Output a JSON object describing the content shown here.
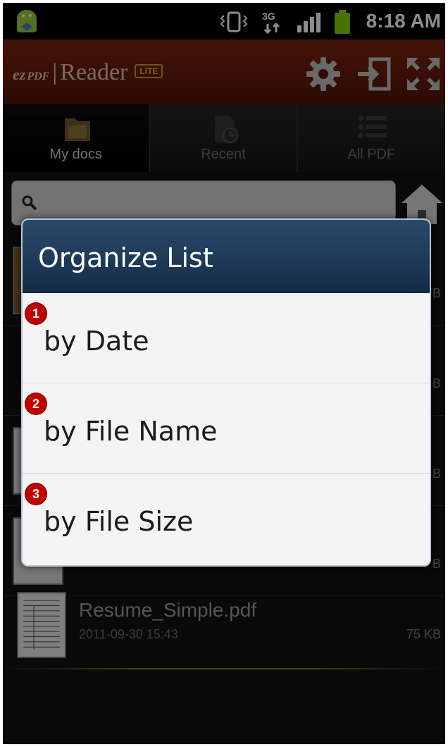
{
  "status_bar": {
    "time": "8:18 AM",
    "network_label": "3G",
    "icons": [
      "android-icon",
      "vibrate-icon",
      "network-3g-icon",
      "signal-icon",
      "battery-icon"
    ]
  },
  "app_header": {
    "logo_ez": "ez",
    "logo_pdf": "PDF",
    "logo_sep": "|",
    "logo_reader": "Reader",
    "logo_lite": "LITE",
    "icons": [
      "settings-icon",
      "import-icon",
      "fullscreen-icon"
    ]
  },
  "tabs": [
    {
      "label": "My docs",
      "icon": "folder-icon",
      "active": true
    },
    {
      "label": "Recent",
      "icon": "recent-icon",
      "active": false
    },
    {
      "label": "All PDF",
      "icon": "list-icon",
      "active": false
    }
  ],
  "search": {
    "icon": "search-icon"
  },
  "file_list": {
    "rows": [
      {
        "name": "",
        "date": "",
        "size": "B"
      },
      {
        "name": "",
        "date": "",
        "size": "B"
      },
      {
        "name": "",
        "date": "",
        "size": "B"
      },
      {
        "name": "",
        "date": "",
        "size": "B"
      },
      {
        "name": "Resume_Simple.pdf",
        "date": "2011-09-30 15:43",
        "size": "75 KB"
      }
    ]
  },
  "dialog": {
    "title": "Organize List",
    "options": [
      {
        "badge": "1",
        "label": "by Date"
      },
      {
        "badge": "2",
        "label": "by File Name"
      },
      {
        "badge": "3",
        "label": "by File Size"
      }
    ]
  },
  "colors": {
    "header_red": "#6a1c0c",
    "dialog_blue": "#1e3a58",
    "badge_red": "#c00000",
    "dialog_bg": "#f4f4f4"
  }
}
